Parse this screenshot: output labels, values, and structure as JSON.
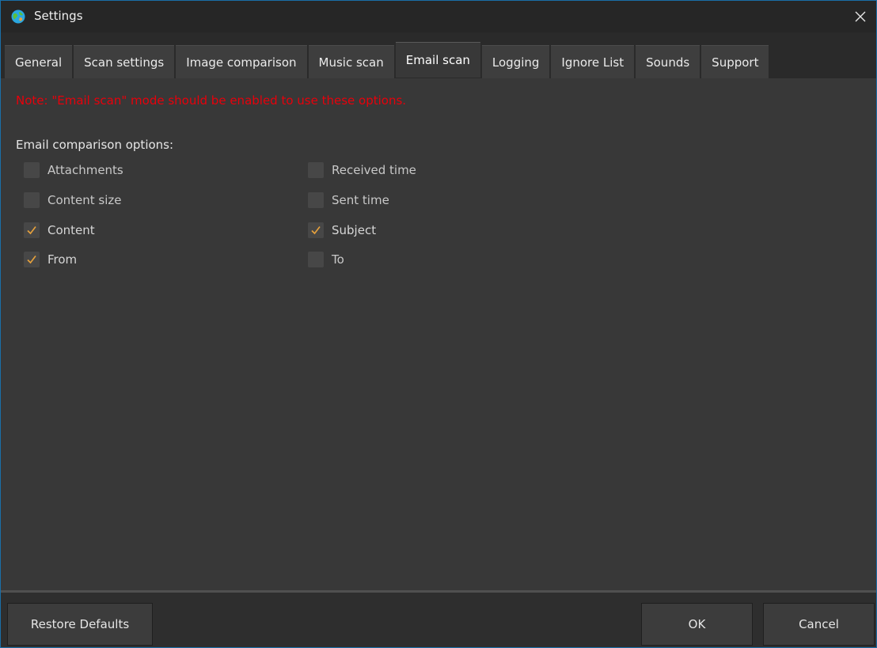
{
  "window": {
    "title": "Settings",
    "icon": "globe-icon",
    "close_icon": "close-icon"
  },
  "tabs": [
    {
      "label": "General",
      "active": false
    },
    {
      "label": "Scan settings",
      "active": false
    },
    {
      "label": "Image comparison",
      "active": false
    },
    {
      "label": "Music scan",
      "active": false
    },
    {
      "label": "Email scan",
      "active": true
    },
    {
      "label": "Logging",
      "active": false
    },
    {
      "label": "Ignore List",
      "active": false
    },
    {
      "label": "Sounds",
      "active": false
    },
    {
      "label": "Support",
      "active": false
    }
  ],
  "content": {
    "note": "Note: \"Email scan\" mode should be enabled to use these options.",
    "section_label": "Email comparison options:",
    "options_left": [
      {
        "label": "Attachments",
        "checked": false
      },
      {
        "label": "Content size",
        "checked": false
      },
      {
        "label": "Content",
        "checked": true
      },
      {
        "label": "From",
        "checked": true
      }
    ],
    "options_right": [
      {
        "label": "Received time",
        "checked": false
      },
      {
        "label": "Sent time",
        "checked": false
      },
      {
        "label": "Subject",
        "checked": true
      },
      {
        "label": "To",
        "checked": false
      }
    ]
  },
  "buttons": {
    "restore_defaults": "Restore Defaults",
    "ok": "OK",
    "cancel": "Cancel"
  },
  "colors": {
    "note_red": "#e8000b",
    "check_orange": "#e8a23c",
    "border_blue": "#1a6fa8"
  }
}
